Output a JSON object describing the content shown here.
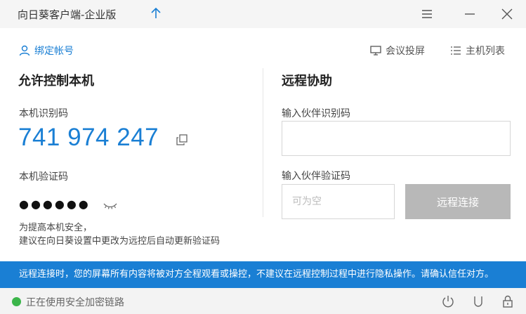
{
  "titlebar": {
    "title": "向日葵客户端-企业版"
  },
  "top_links": {
    "bind_account": "绑定帐号",
    "meeting_cast": "会议投屏",
    "host_list": "主机列表"
  },
  "allow_control": {
    "title": "允许控制本机",
    "id_label": "本机识别码",
    "machine_id": "741 974 247",
    "code_label": "本机验证码",
    "code_masked": "●●●●●●",
    "tip_line1": "为提高本机安全，",
    "tip_line2": "建议在向日葵设置中更改为远控后自动更新验证码"
  },
  "remote_assist": {
    "title": "远程协助",
    "partner_id_label": "输入伙伴识别码",
    "partner_id_value": "",
    "partner_code_label": "输入伙伴验证码",
    "partner_code_placeholder": "可为空",
    "connect_label": "远程连接"
  },
  "warning": "远程连接时，您的屏幕所有内容将被对方全程观看或操控，不建议在远程控制过程中进行隐私操作。请确认信任对方。",
  "status": {
    "text": "正在使用安全加密链路"
  },
  "colors": {
    "accent": "#1a7fd4",
    "status_ok": "#3bb54a",
    "disabled_button": "#b8b8b8"
  }
}
